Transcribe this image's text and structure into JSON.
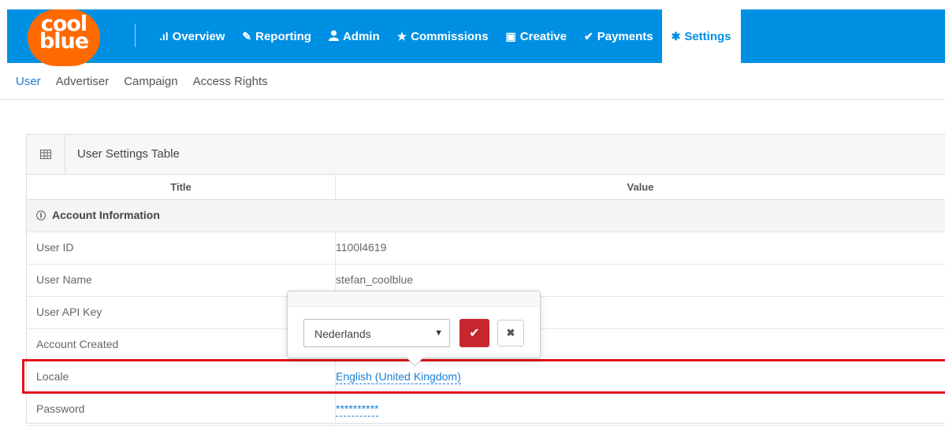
{
  "brand": {
    "line1": "cool",
    "line2": "blue",
    "color": "#ff6a00"
  },
  "nav": {
    "accent": "#0090e3",
    "items": [
      {
        "icon": "bar-chart-icon",
        "glyph": ".ıl",
        "label": "Overview"
      },
      {
        "icon": "pencil-icon",
        "glyph": "✎",
        "label": "Reporting"
      },
      {
        "icon": "user-icon",
        "glyph": "👤",
        "label": "Admin"
      },
      {
        "icon": "star-icon",
        "glyph": "★",
        "label": "Commissions"
      },
      {
        "icon": "image-icon",
        "glyph": "▣",
        "label": "Creative"
      },
      {
        "icon": "check-icon",
        "glyph": "✔",
        "label": "Payments"
      },
      {
        "icon": "gear-icon",
        "glyph": "✱",
        "label": "Settings",
        "active": true
      }
    ]
  },
  "subnav": [
    "User",
    "Advertiser",
    "Campaign",
    "Access Rights"
  ],
  "panel": {
    "title": "User Settings Table",
    "col_title": "Title",
    "col_value": "Value",
    "section": "Account Information",
    "rows": [
      {
        "title": "User ID",
        "value": "1100l4619"
      },
      {
        "title": "User Name",
        "value": "stefan_coolblue"
      },
      {
        "title": "User API Key",
        "value": ""
      },
      {
        "title": "Account Created",
        "value": ""
      },
      {
        "title": "Locale",
        "value": "English (United Kingdom)"
      },
      {
        "title": "Password",
        "value": "**********"
      }
    ]
  },
  "popover": {
    "selected": "Nederlands",
    "highlight_color": "#e3121d"
  }
}
